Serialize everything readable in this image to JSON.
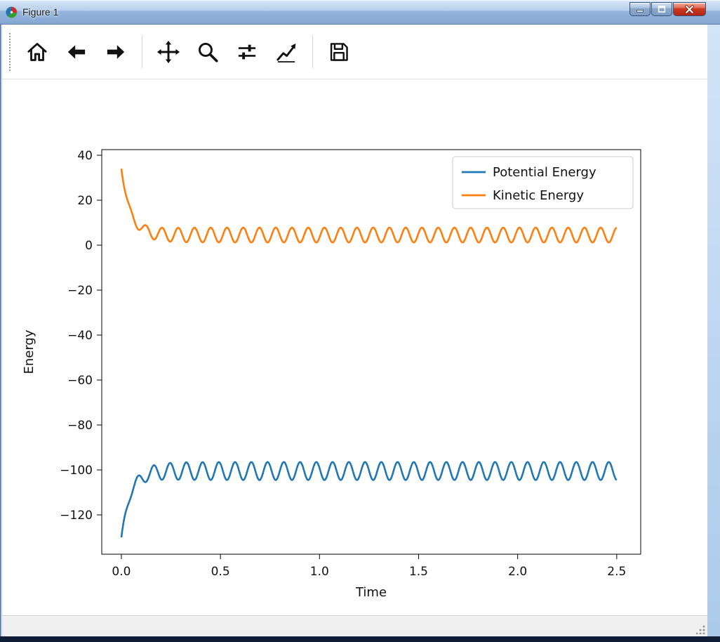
{
  "window": {
    "title": "Figure 1"
  },
  "titlebar": {
    "controls": [
      "minimize",
      "maximize",
      "close"
    ]
  },
  "toolbar": {
    "tools": [
      "home",
      "back",
      "forward",
      "pan",
      "zoom",
      "configure-subplots",
      "edit-parameters",
      "save"
    ]
  },
  "statusbar": {
    "text": ""
  },
  "chart_data": {
    "type": "line",
    "title": "",
    "xlabel": "Time",
    "ylabel": "Energy",
    "x_range": [
      0,
      2.5
    ],
    "xlim": [
      -0.099,
      2.621
    ],
    "ylim": [
      -137.5,
      42.5
    ],
    "xticks": [
      0.0,
      0.5,
      1.0,
      1.5,
      2.0,
      2.5
    ],
    "xtick_labels": [
      "0.0",
      "0.5",
      "1.0",
      "1.5",
      "2.0",
      "2.5"
    ],
    "yticks": [
      40,
      20,
      0,
      -20,
      -40,
      -60,
      -80,
      -100,
      -120
    ],
    "ytick_labels": [
      "40",
      "20",
      "0",
      "−20",
      "−40",
      "−60",
      "−80",
      "−100",
      "−120"
    ],
    "grid": false,
    "frame": true,
    "background": "#ffffff",
    "legend": {
      "position": "upper right",
      "entries": [
        "Potential Energy",
        "Kinetic Energy"
      ]
    },
    "series": [
      {
        "id": "potential-energy",
        "name": "Potential Energy",
        "color": "#1f77b4",
        "description": "Starts at about -130 at t=0, rises rapidly within t<0.15, then oscillates around -100 between about -105 and -96 with period ~0.082",
        "model": {
          "baseline": -100.5,
          "jump": -29.5,
          "decay_tau": 0.045,
          "amplitude": 4.0,
          "period": 0.082,
          "phase": 1.5708,
          "ramp_tau": 0.09
        }
      },
      {
        "id": "kinetic-energy",
        "name": "Kinetic Energy",
        "color": "#ff7f0e",
        "description": "Starts at about 34 at t=0, drops rapidly within t<0.15, then oscillates around 4.5 between about 1 and 8 with period ~0.082",
        "model": {
          "baseline": 4.5,
          "jump": 29.5,
          "decay_tau": 0.045,
          "amplitude": 3.3,
          "period": 0.082,
          "phase": -1.5708,
          "ramp_tau": 0.09
        }
      }
    ]
  }
}
